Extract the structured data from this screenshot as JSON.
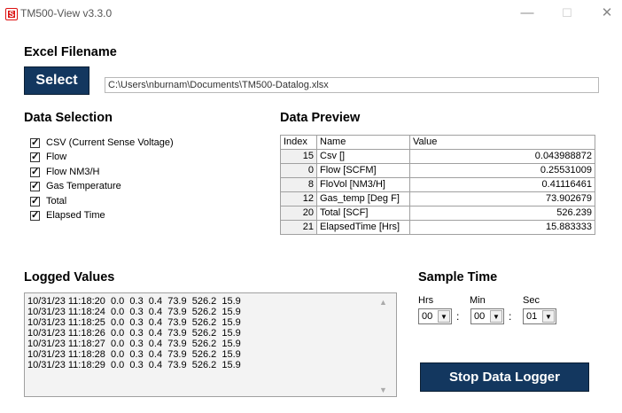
{
  "window": {
    "title": "TM500-View v3.3.0",
    "icon_letter": "S",
    "minimize_glyph": "—",
    "maximize_glyph": "☐",
    "close_glyph": "✕"
  },
  "excel": {
    "heading": "Excel Filename",
    "select_label": "Select",
    "path": "C:\\Users\\nburnam\\Documents\\TM500-Datalog.xlsx"
  },
  "selection": {
    "heading": "Data Selection",
    "items": [
      {
        "label": "CSV (Current Sense Voltage)",
        "checked": true
      },
      {
        "label": "Flow",
        "checked": true
      },
      {
        "label": "Flow NM3/H",
        "checked": true
      },
      {
        "label": "Gas Temperature",
        "checked": true
      },
      {
        "label": "Total",
        "checked": true
      },
      {
        "label": "Elapsed Time",
        "checked": true
      }
    ]
  },
  "preview": {
    "heading": "Data Preview",
    "columns": [
      "Index",
      "Name",
      "Value"
    ],
    "rows": [
      {
        "index": "15",
        "name": "Csv []",
        "value": "0.043988872"
      },
      {
        "index": "0",
        "name": "Flow [SCFM]",
        "value": "0.25531009"
      },
      {
        "index": "8",
        "name": "FloVol [NM3/H]",
        "value": "0.41116461"
      },
      {
        "index": "12",
        "name": "Gas_temp [Deg F]",
        "value": "73.902679"
      },
      {
        "index": "20",
        "name": "Total [SCF]",
        "value": "526.239"
      },
      {
        "index": "21",
        "name": "ElapsedTime [Hrs]",
        "value": "15.883333"
      }
    ]
  },
  "logged": {
    "heading": "Logged Values",
    "lines": [
      "10/31/23 11:18:20  0.0  0.3  0.4  73.9  526.2  15.9",
      "10/31/23 11:18:24  0.0  0.3  0.4  73.9  526.2  15.9",
      "10/31/23 11:18:25  0.0  0.3  0.4  73.9  526.2  15.9",
      "10/31/23 11:18:26  0.0  0.3  0.4  73.9  526.2  15.9",
      "10/31/23 11:18:27  0.0  0.3  0.4  73.9  526.2  15.9",
      "10/31/23 11:18:28  0.0  0.3  0.4  73.9  526.2  15.9",
      "10/31/23 11:18:29  0.0  0.3  0.4  73.9  526.2  15.9"
    ]
  },
  "sample": {
    "heading": "Sample Time",
    "hrs_label": "Hrs",
    "min_label": "Min",
    "sec_label": "Sec",
    "hrs": "00",
    "min": "00",
    "sec": "01",
    "separator": ":"
  },
  "stop_label": "Stop Data Logger",
  "colors": {
    "button_bg": "#13375f",
    "button_text": "#ffffff",
    "icon_red": "#dd1111"
  }
}
